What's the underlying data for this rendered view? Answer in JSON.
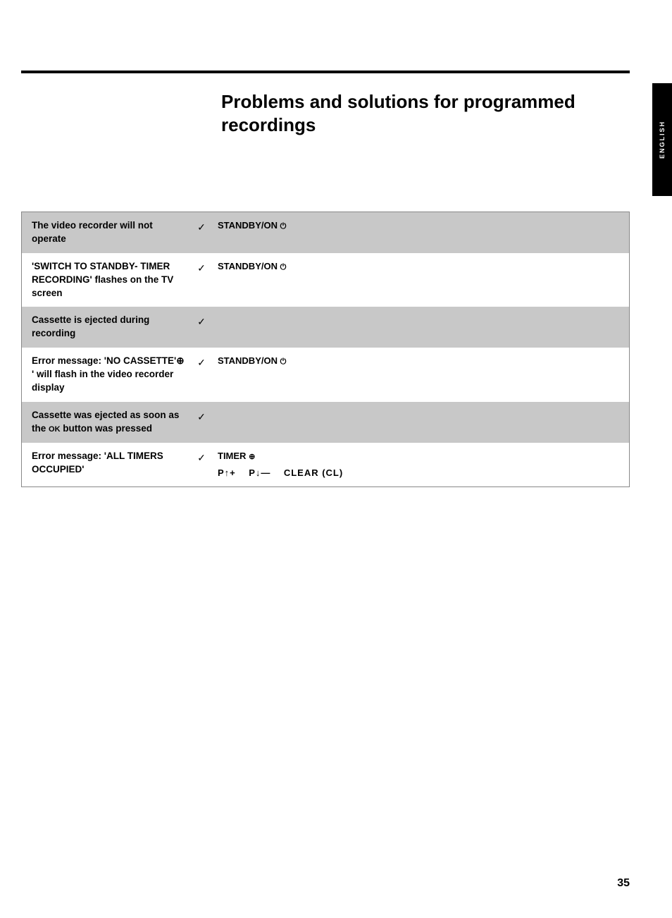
{
  "page": {
    "page_number": "35",
    "side_label": "ENGLISH",
    "title": "Problems and solutions for programmed recordings"
  },
  "table": {
    "rows": [
      {
        "id": "row1",
        "shaded": true,
        "problem": "The video recorder will not operate",
        "check": "✓",
        "solution": "STANDBY/ON ⏻"
      },
      {
        "id": "row2",
        "shaded": false,
        "problem": "'SWITCH TO STANDBY- TIMER RECORDING' flashes on the TV screen",
        "check": "✓",
        "solution": "STANDBY/ON ⏻"
      },
      {
        "id": "row3",
        "shaded": true,
        "problem": "Cassette is ejected during recording",
        "check": "✓",
        "solution": ""
      },
      {
        "id": "row4",
        "shaded": false,
        "problem": "Error message: 'NO CASSETTE'⊕ ' will flash in the video recorder display",
        "check": "✓",
        "solution": "STANDBY/ON ⏻"
      },
      {
        "id": "row5",
        "shaded": true,
        "problem": "Cassette was ejected as soon as the OK button was pressed",
        "check": "✓",
        "solution": ""
      },
      {
        "id": "row6",
        "shaded": false,
        "problem": "Error message: 'ALL TIMERS OCCUPIED'",
        "check": "✓",
        "solution_line1": "TIMER ⊕",
        "solution_line2": "P↑+    P↓—    CLEAR (CL)"
      }
    ]
  }
}
